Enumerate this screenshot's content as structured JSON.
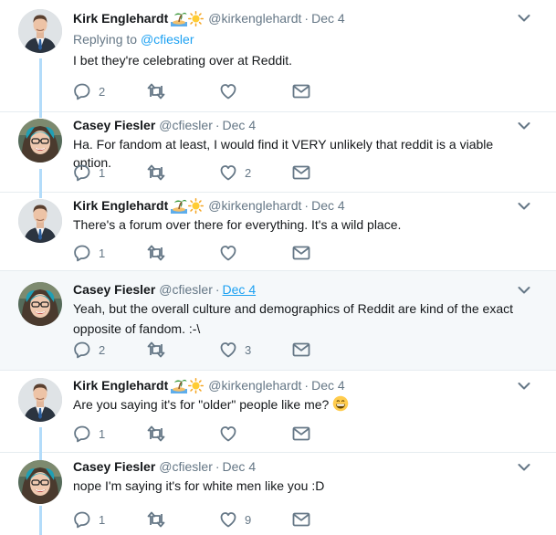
{
  "tweets": [
    {
      "name": "Kirk Englehardt",
      "handle": "@kirkenglehardt",
      "sep": "·",
      "time": "Dec 4",
      "reply_label": "Replying to",
      "reply_mention": "@cfiesler",
      "text": "I bet they're celebrating over at Reddit.",
      "reply_count": "2",
      "retweet_count": "",
      "like_count": ""
    },
    {
      "name": "Casey Fiesler",
      "handle": "@cfiesler",
      "sep": "·",
      "time": "Dec 4",
      "text": "Ha. For fandom at least, I would find it VERY unlikely that reddit is a viable option.",
      "reply_count": "1",
      "retweet_count": "",
      "like_count": "2"
    },
    {
      "name": "Kirk Englehardt",
      "handle": "@kirkenglehardt",
      "sep": "·",
      "time": "Dec 4",
      "text": "There's a forum over there for everything. It's a wild place.",
      "reply_count": "1",
      "retweet_count": "",
      "like_count": ""
    },
    {
      "name": "Casey Fiesler",
      "handle": "@cfiesler",
      "sep": "·",
      "time": "Dec 4",
      "text_line1": "Yeah, but the overall culture and demographics of Reddit are kind of the exact",
      "text_line2": "opposite of fandom. :-\\",
      "reply_count": "2",
      "retweet_count": "",
      "like_count": "3"
    },
    {
      "name": "Kirk Englehardt",
      "handle": "@kirkenglehardt",
      "sep": "·",
      "time": "Dec 4",
      "text": "Are you saying it's for \"older\" people like me?",
      "reply_count": "1",
      "retweet_count": "",
      "like_count": ""
    },
    {
      "name": "Casey Fiesler",
      "handle": "@cfiesler",
      "sep": "·",
      "time": "Dec 4",
      "text": "nope I'm saying it's for white men like you :D",
      "reply_count": "1",
      "retweet_count": "",
      "like_count": "9"
    }
  ],
  "icons": {
    "reply": "reply-icon",
    "retweet": "retweet-icon",
    "like": "heart-icon",
    "dm": "envelope-icon",
    "more": "chevron-down-icon",
    "beach": "island-icon",
    "sun": "sun-icon",
    "grin": "grinning-face-icon"
  },
  "colors": {
    "accent": "#1da1f2",
    "thread_line": "#b3dcfa",
    "muted": "#657786",
    "highlight_bg": "#f5f8fa"
  }
}
